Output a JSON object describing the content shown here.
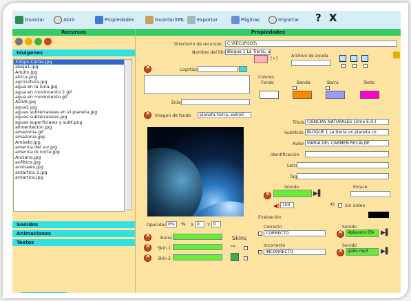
{
  "toolbar": {
    "items": [
      "Guardar",
      "Abrir",
      "Propiedades",
      "GuardarXML",
      "Exportar",
      "Páginas",
      "Importar"
    ],
    "help": "?",
    "close": "X"
  },
  "left": {
    "header": "Recursos",
    "images_label": "Imágenes",
    "files": [
      "330px-Cartel.jpg",
      "abeja1.jpg",
      "Adulto.jpg",
      "africa.png",
      "agricultura.jpg",
      "agua en la luna.jpg",
      "agua en movimiento 2.gif",
      "agua en movimiento.gif",
      "AGUA.jpg",
      "agua2.jpg",
      "aguas subterraneas en el planeta.jpg",
      "aguas subterraneas.jpg",
      "aguas superficiales y subt.png",
      "alimentacion.jpg",
      "amazonia.gif",
      "amazonia.jpg",
      "Ambato.jpg",
      "america del sur.jpg",
      "america di norte.jpg",
      "Anciano.jpg",
      "anfibios.jpg",
      "animales.jpg",
      "antartica 2.jpg",
      "antartica.jpg"
    ],
    "sections": [
      "Sonidos",
      "Animaciones",
      "Textos"
    ]
  },
  "right": {
    "header": "Propiedades",
    "resource_dir_label": "Directorio de recursos:",
    "resource_dir_value": "C:\\RECURSOS\\",
    "book_name_label": "Nombre del libro",
    "book_name_value": "Bloque 1 La Tierra, un pl",
    "logotipo_label": "Logotipo",
    "enlace_label": "Enlace",
    "bg_image_label": "Imagen de fondo",
    "bg_image_value": "planeta-tierra,-extrell",
    "help_file_label": "Archivo de ayuda",
    "colores_label": "Colores",
    "fondo_label": "Fondo",
    "banda_label": "Banda",
    "barra_label": "Barra",
    "texto_label": "Texto",
    "colors": {
      "fondo": "#ffffff",
      "banda": "#ff8800",
      "barra": "#9999ff",
      "texto": "#ff00cc"
    },
    "titulo_label": "Título",
    "titulo_value": "CIENCIAS NATURALES 10mo E.G.I",
    "subtitulo_label": "Subtítulo",
    "subtitulo_value": "BLOQUE 1 La tierra un planeta co",
    "autor_label": "Autor",
    "autor_value": "MARIA DEL CARMEN RECALDE",
    "identificacion_label": "Identificación",
    "letras_label": "Letras",
    "tag_label": "Tag",
    "sonido_label": "Sonido",
    "enlace2_label": "Enlace",
    "volume_value": "100",
    "sin_orden_label": "Sin orden",
    "opacidad_label": "Opacidad",
    "opacidad_value": "0%",
    "x_label": "X",
    "x_value": "0",
    "y_label": "Y",
    "y_value": "0",
    "barra2_label": "Barra",
    "skin1_label": "Skin 1",
    "skin2_label": "Skin 2",
    "skins_label": "Skins",
    "evaluacion_label": "Evaluación",
    "correcto_label": "Correcto",
    "correcto_value": "CORRECTO",
    "incorrecto_label": "Incorrecto",
    "incorrecto_value": "INCORRECTO",
    "sonido_ok_label": "Sonido",
    "sonido_ok_value": "Aplausos  Efe",
    "sonido_bad_label": "Sonido",
    "sonido_bad_value": "gallo.mp3"
  }
}
